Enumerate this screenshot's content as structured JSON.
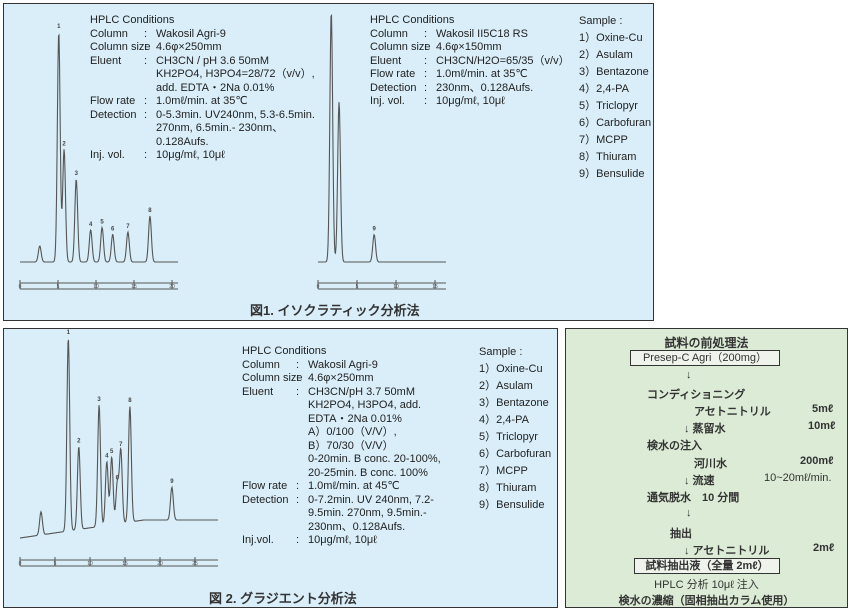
{
  "figure1": {
    "caption": "図1. イソクラティック分析法",
    "left_conditions": {
      "title": "HPLC Conditions",
      "rows": [
        {
          "label": "Column",
          "value": [
            "Wakosil Agri-9"
          ]
        },
        {
          "label": "Column size",
          "value": [
            "4.6φ×250mm"
          ]
        },
        {
          "label": "Eluent",
          "value": [
            "CH3CN / pH 3.6 50mM",
            "KH2PO4, H3PO4=28/72（v/v）,",
            "add. EDTA・2Na 0.01%"
          ]
        },
        {
          "label": "Flow rate",
          "value": [
            "1.0mℓ/min. at 35℃"
          ]
        },
        {
          "label": "Detection",
          "value": [
            "0-5.3min. UV240nm, 5.3-6.5min.",
            "270nm, 6.5min.- 230nm、",
            "0.128Aufs."
          ]
        },
        {
          "label": "Inj. vol.",
          "value": [
            "10μg/mℓ, 10μℓ"
          ]
        }
      ]
    },
    "right_conditions": {
      "title": "HPLC Conditions",
      "rows": [
        {
          "label": "Column",
          "value": [
            "Wakosil II5C18 RS"
          ]
        },
        {
          "label": "Column size",
          "value": [
            "4.6φ×150mm"
          ]
        },
        {
          "label": "Eluent",
          "value": [
            "CH3CN/H2O=65/35（v/v）"
          ]
        },
        {
          "label": "Flow rate",
          "value": [
            "1.0mℓ/min. at 35℃"
          ]
        },
        {
          "label": "Detection",
          "value": [
            "230nm、0.128Aufs."
          ]
        },
        {
          "label": "Inj. vol.",
          "value": [
            "10μg/mℓ, 10μℓ"
          ]
        }
      ]
    },
    "sample_title": "Sample :",
    "samples": [
      "1）Oxine-Cu",
      "2）Asulam",
      "3）Bentazone",
      "4）2,4-PA",
      "5）Triclopyr",
      "6）Carbofuran",
      "7）MCPP",
      "8）Thiuram",
      "9）Bensulide"
    ]
  },
  "figure2": {
    "caption": "図 2. グラジエント分析法",
    "conditions": {
      "title": "HPLC Conditions",
      "rows": [
        {
          "label": "Column",
          "value": [
            "Wakosil Agri-9"
          ]
        },
        {
          "label": "Column size",
          "value": [
            "4.6φ×250mm"
          ]
        },
        {
          "label": "Eluent",
          "value": [
            "CH3CN/pH 3.7 50mM",
            "KH2PO4, H3PO4, add.",
            "EDTA・2Na 0.01%",
            "A）0/100（V/V）,",
            "B）70/30（V/V）",
            "0-20min. B conc. 20-100%,",
            "20-25min. B conc. 100%"
          ]
        },
        {
          "label": "Flow rate",
          "value": [
            "1.0mℓ/min. at 45℃"
          ]
        },
        {
          "label": "Detection",
          "value": [
            "0-7.2min. UV 240nm, 7.2-",
            "9.5min. 270nm, 9.5min.-",
            "230nm、0.128Aufs."
          ]
        },
        {
          "label": "Inj.vol.",
          "value": [
            "10μg/mℓ, 10μℓ"
          ]
        }
      ]
    },
    "sample_title": "Sample :",
    "samples": [
      "1）Oxine-Cu",
      "2）Asulam",
      "3）Bentazone",
      "4）2,4-PA",
      "5）Triclopyr",
      "6）Carbofuran",
      "7）MCPP",
      "8）Thiuram",
      "9）Bensulide"
    ]
  },
  "pretreatment": {
    "title": "試料の前処理法",
    "cartridge": "Presep-C Agri（200mg）",
    "step_conditioning": "コンディショニング",
    "acetonitrile": "アセトニトリル",
    "acetonitrile_vol": "5mℓ",
    "water": "↓ 蒸留水",
    "water_vol": "10mℓ",
    "injection": "検水の注入",
    "river_water": "河川水",
    "river_vol": "200mℓ",
    "flow": "↓ 流速",
    "flow_val": "10~20mℓ/min.",
    "dry": "通気脱水　10 分間",
    "arrow": "↓",
    "elution": "抽出",
    "elute_solvent": "↓ アセトニトリル",
    "elute_vol": "2mℓ",
    "extract": "試料抽出液（全量 2mℓ）",
    "hplc": "HPLC 分析 10μℓ 注入",
    "footer": "検水の濃縮（固相抽出カラム使用）"
  },
  "chart_data": [
    {
      "type": "line",
      "name_hint": "",
      "x_unit": "min",
      "xlim": [
        0,
        21
      ],
      "xticks": [
        0,
        5,
        10,
        15,
        20
      ],
      "peaks": [
        {
          "label": "",
          "t": 2.6,
          "h": 7
        },
        {
          "label": "1",
          "t": 5.1,
          "h": 100
        },
        {
          "label": "2",
          "t": 5.8,
          "h": 49
        },
        {
          "label": "3",
          "t": 7.4,
          "h": 36
        },
        {
          "label": "4",
          "t": 9.3,
          "h": 14
        },
        {
          "label": "5",
          "t": 10.8,
          "h": 15
        },
        {
          "label": "6",
          "t": 12.2,
          "h": 12
        },
        {
          "label": "7",
          "t": 14.2,
          "h": 13
        },
        {
          "label": "8",
          "t": 17.1,
          "h": 20
        }
      ]
    },
    {
      "type": "line",
      "x_unit": "min",
      "xlim": [
        0,
        16
      ],
      "xticks": [
        0,
        5,
        10,
        15
      ],
      "peaks": [
        {
          "label": "",
          "t": 1.7,
          "h": 100
        },
        {
          "label": "",
          "t": 2.7,
          "h": 64
        },
        {
          "label": "9",
          "t": 7.2,
          "h": 11
        }
      ]
    },
    {
      "type": "line",
      "x_unit": "min",
      "xlim": [
        0,
        28
      ],
      "xticks": [
        0,
        5,
        10,
        15,
        20,
        25
      ],
      "peaks": [
        {
          "label": "",
          "t": 3.0,
          "h": 12
        },
        {
          "label": "1",
          "t": 6.9,
          "h": 100
        },
        {
          "label": "2",
          "t": 8.4,
          "h": 43
        },
        {
          "label": "3",
          "t": 11.3,
          "h": 63
        },
        {
          "label": "4",
          "t": 12.4,
          "h": 33
        },
        {
          "label": "5",
          "t": 13.1,
          "h": 35
        },
        {
          "label": "6",
          "t": 13.9,
          "h": 21
        },
        {
          "label": "7",
          "t": 14.4,
          "h": 38
        },
        {
          "label": "8",
          "t": 15.7,
          "h": 60
        },
        {
          "label": "9",
          "t": 21.7,
          "h": 17
        }
      ]
    }
  ]
}
